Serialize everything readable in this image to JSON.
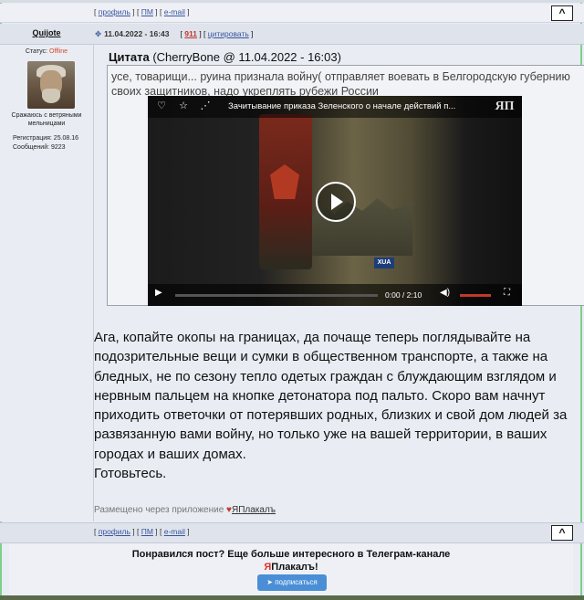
{
  "top_links": {
    "profile": "профиль",
    "pm": "ПМ",
    "email": "e-mail"
  },
  "uparrow_label": "^",
  "post": {
    "author": "Quijote",
    "date": "11.04.2022 - 16:43",
    "number": "911",
    "quote_link": "цитировать"
  },
  "sidebar": {
    "status_label": "Статус:",
    "status_value": "Offline",
    "tagline": "Сражаюсь с ветряными мельницами",
    "registration": "Регистрация: 25.08.16",
    "messages": "Сообщений: 9223"
  },
  "quote": {
    "label": "Цитата",
    "source": "(CherryBone @ 11.04.2022 - 16:03)",
    "text": "усе, товарищи... руина признала войну( отправляет воевать в Белгородскую губернию своих защитников, надо укреплять рубежи России"
  },
  "video": {
    "title": "Зачитывание приказа Зеленского о начале действий п...",
    "time": "0:00  /  2:10",
    "channel_badge": "XUA",
    "brand": "ЯП"
  },
  "body_text": "Ага, копайте окопы на границах, да почаще теперь поглядывайте на подозрительные вещи и сумки в общественном транспорте, а также на бледных, не по сезону тепло одетых граждан с блуждающим взглядом и нервным пальцем на кнопке детонатора под пальто. Скоро вам начнут приходить ответочки от потерявших родных, близких и свой дом людей за развязанную вами войну, но только уже на вашей территории, в ваших городах и ваших домах.",
  "body_text_end": "Готовьтесь.",
  "via": {
    "label": "Размещено через приложение",
    "app": "ЯПлакалъ"
  },
  "promo": {
    "line1": "Понравился пост? Еще больше интересного в Телеграм-канале",
    "line2_red": "Я",
    "line2_rest": "Плакалъ!",
    "button": "подписаться"
  },
  "colors": {
    "accent": "#3b56a0",
    "offline": "#d64a2a",
    "subscribe": "#4a8ed6",
    "brand_red": "#d8352a"
  }
}
